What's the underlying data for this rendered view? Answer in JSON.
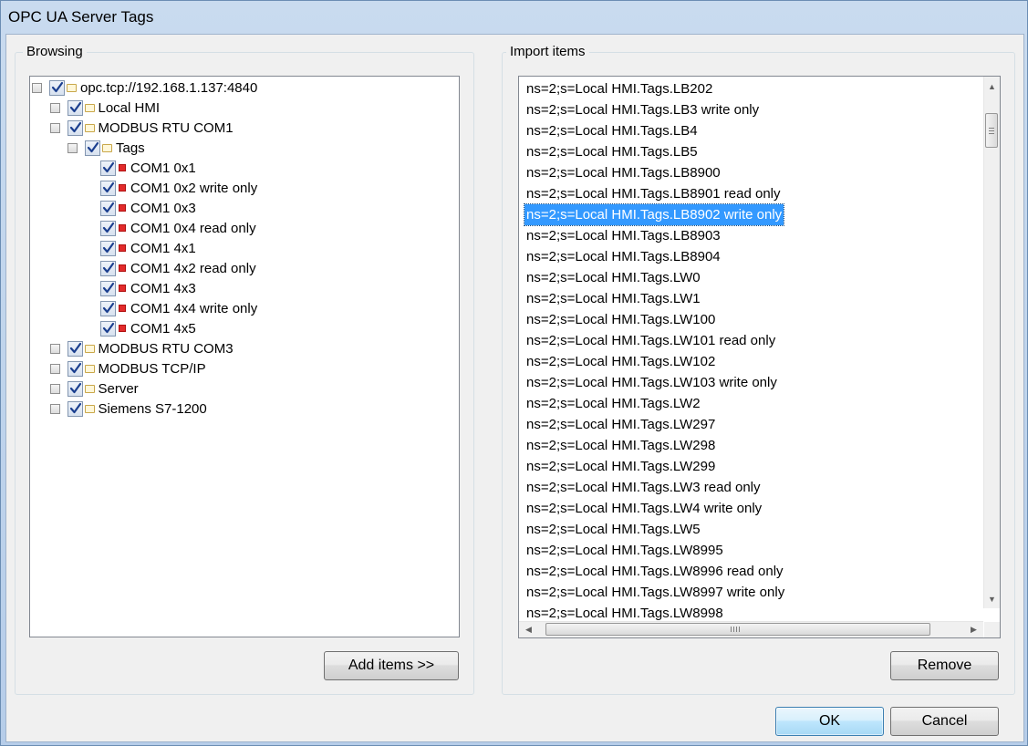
{
  "window": {
    "title": "OPC UA Server Tags"
  },
  "browsing": {
    "label": "Browsing",
    "tree": [
      {
        "text": "opc.tcp://192.168.1.137:4840",
        "level": 0,
        "kind": "folder"
      },
      {
        "text": "Local HMI",
        "level": 1,
        "kind": "folder"
      },
      {
        "text": "MODBUS RTU COM1",
        "level": 1,
        "kind": "folder"
      },
      {
        "text": "Tags",
        "level": 2,
        "kind": "folder"
      },
      {
        "text": "COM1 0x1",
        "level": 3,
        "kind": "tag"
      },
      {
        "text": "COM1 0x2 write only",
        "level": 3,
        "kind": "tag"
      },
      {
        "text": "COM1 0x3",
        "level": 3,
        "kind": "tag"
      },
      {
        "text": "COM1 0x4 read only",
        "level": 3,
        "kind": "tag"
      },
      {
        "text": "COM1 4x1",
        "level": 3,
        "kind": "tag"
      },
      {
        "text": "COM1 4x2 read only",
        "level": 3,
        "kind": "tag"
      },
      {
        "text": "COM1 4x3",
        "level": 3,
        "kind": "tag"
      },
      {
        "text": "COM1 4x4 write only",
        "level": 3,
        "kind": "tag"
      },
      {
        "text": "COM1 4x5",
        "level": 3,
        "kind": "tag"
      },
      {
        "text": "MODBUS RTU COM3",
        "level": 1,
        "kind": "folder"
      },
      {
        "text": "MODBUS TCP/IP",
        "level": 1,
        "kind": "folder"
      },
      {
        "text": "Server",
        "level": 1,
        "kind": "folder"
      },
      {
        "text": "Siemens S7-1200",
        "level": 1,
        "kind": "folder"
      }
    ],
    "add_button": "Add items >>"
  },
  "import": {
    "label": "Import items",
    "selected_index": 6,
    "items": [
      "ns=2;s=Local HMI.Tags.LB202",
      "ns=2;s=Local HMI.Tags.LB3 write only",
      "ns=2;s=Local HMI.Tags.LB4",
      "ns=2;s=Local HMI.Tags.LB5",
      "ns=2;s=Local HMI.Tags.LB8900",
      "ns=2;s=Local HMI.Tags.LB8901 read only",
      "ns=2;s=Local HMI.Tags.LB8902 write only",
      "ns=2;s=Local HMI.Tags.LB8903",
      "ns=2;s=Local HMI.Tags.LB8904",
      "ns=2;s=Local HMI.Tags.LW0",
      "ns=2;s=Local HMI.Tags.LW1",
      "ns=2;s=Local HMI.Tags.LW100",
      "ns=2;s=Local HMI.Tags.LW101 read only",
      "ns=2;s=Local HMI.Tags.LW102",
      "ns=2;s=Local HMI.Tags.LW103 write only",
      "ns=2;s=Local HMI.Tags.LW2",
      "ns=2;s=Local HMI.Tags.LW297",
      "ns=2;s=Local HMI.Tags.LW298",
      "ns=2;s=Local HMI.Tags.LW299",
      "ns=2;s=Local HMI.Tags.LW3 read only",
      "ns=2;s=Local HMI.Tags.LW4 write only",
      "ns=2;s=Local HMI.Tags.LW5",
      "ns=2;s=Local HMI.Tags.LW8995",
      "ns=2;s=Local HMI.Tags.LW8996 read only",
      "ns=2;s=Local HMI.Tags.LW8997 write only",
      "ns=2;s=Local HMI.Tags.LW8998"
    ],
    "remove_button": "Remove"
  },
  "footer": {
    "ok": "OK",
    "cancel": "Cancel"
  },
  "colors": {
    "selection": "#3399ff",
    "tag_marker": "#e22b2b",
    "folder": "#fff7d9"
  }
}
